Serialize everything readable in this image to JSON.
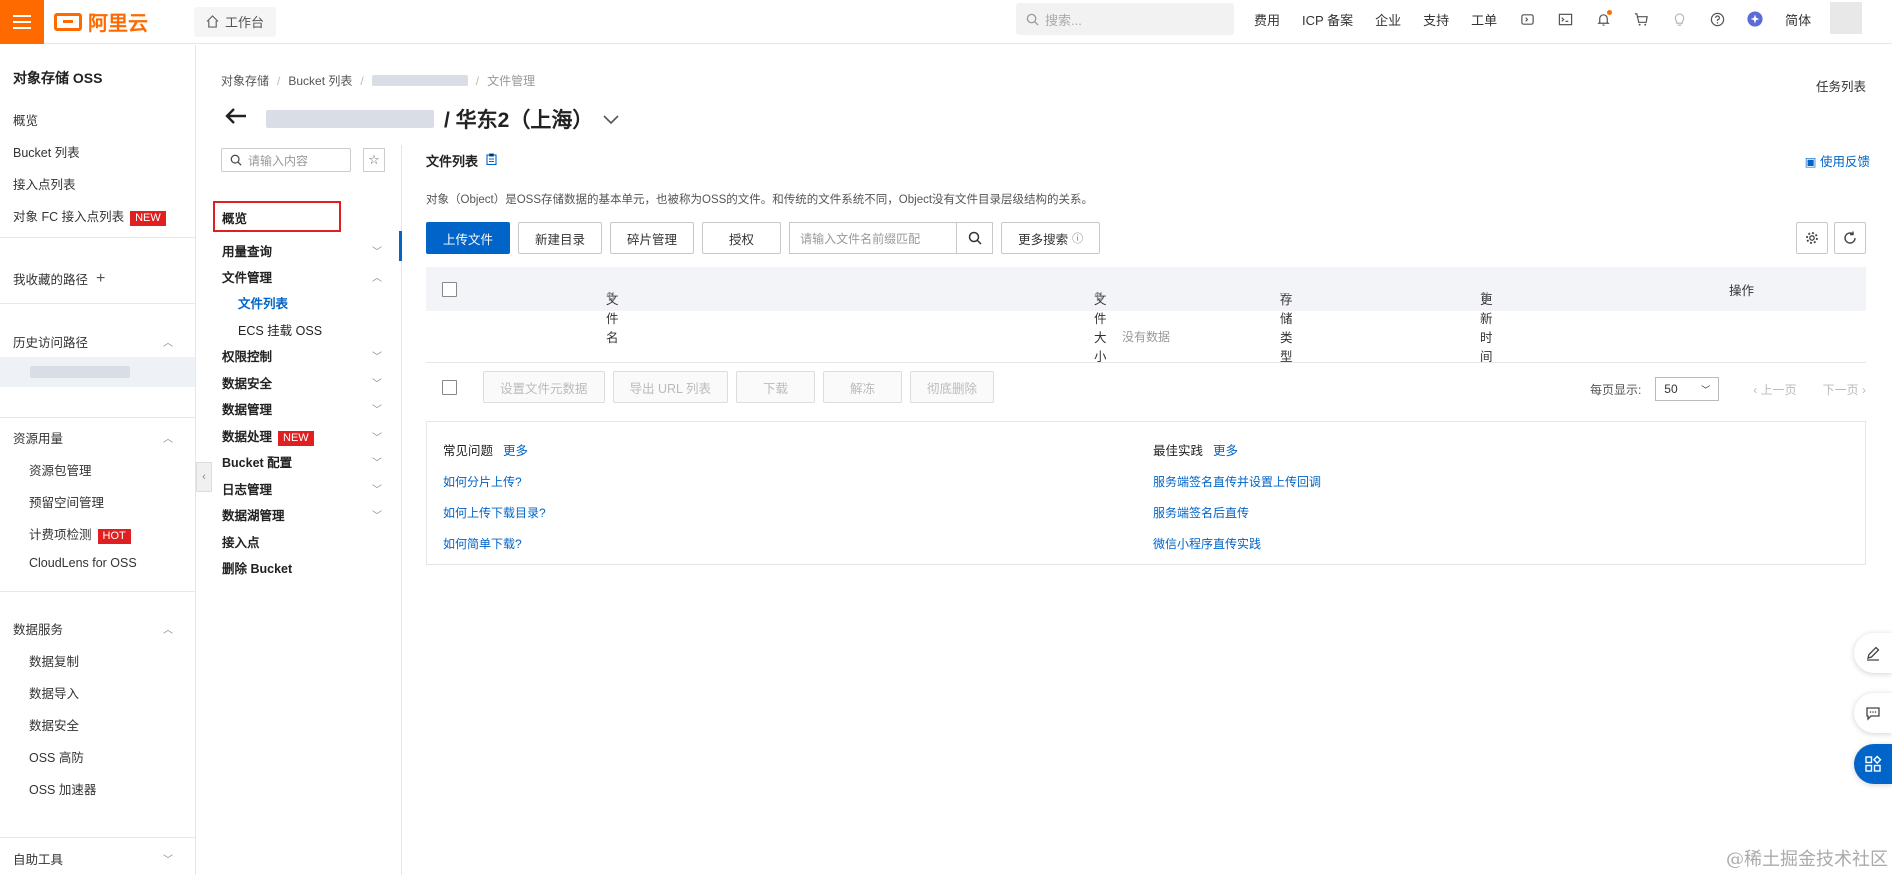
{
  "topbar": {
    "logo_text": "阿里云",
    "workbench": "工作台",
    "search_placeholder": "搜索...",
    "nav": [
      "费用",
      "ICP 备案",
      "企业",
      "支持",
      "工单"
    ],
    "lang": "简体"
  },
  "sidebar": {
    "title": "对象存储 OSS",
    "items": [
      "概览",
      "Bucket 列表",
      "接入点列表",
      "对象 FC 接入点列表"
    ],
    "new_badge": "NEW",
    "favorites": "我收藏的路径",
    "history": "历史访问路径",
    "resource": {
      "label": "资源用量",
      "items": [
        "资源包管理",
        "预留空间管理",
        "计费项检测",
        "CloudLens for OSS"
      ],
      "hot_badge": "HOT"
    },
    "data_service": {
      "label": "数据服务",
      "items": [
        "数据复制",
        "数据导入",
        "数据安全",
        "OSS 高防",
        "OSS 加速器"
      ]
    },
    "self_tools": "自助工具"
  },
  "breadcrumb": {
    "items": [
      "对象存储",
      "Bucket 列表"
    ],
    "current": "文件管理"
  },
  "tasks": "任务列表",
  "bucket_region": "/ 华东2（上海）",
  "subnav": {
    "search_placeholder": "请输入内容",
    "overview": "概览",
    "usage": "用量查询",
    "file_mgmt": "文件管理",
    "file_list": "文件列表",
    "ecs_mount": "ECS 挂载 OSS",
    "perm": "权限控制",
    "data_security": "数据安全",
    "data_mgmt": "数据管理",
    "data_proc": "数据处理",
    "new_badge": "NEW",
    "bucket_config": "Bucket 配置",
    "log_mgmt": "日志管理",
    "lake_mgmt": "数据湖管理",
    "access_point": "接入点",
    "delete_bucket": "删除 Bucket"
  },
  "content": {
    "title": "文件列表",
    "feedback": "使用反馈",
    "description": "对象（Object）是OSS存储数据的基本单元，也被称为OSS的文件。和传统的文件系统不同，Object没有文件目录层级结构的关系。",
    "buttons": {
      "upload": "上传文件",
      "new_dir": "新建目录",
      "fragments": "碎片管理",
      "authorize": "授权",
      "more_search": "更多搜索"
    },
    "filter_placeholder": "请输入文件名前缀匹配",
    "columns": {
      "name": "文件名",
      "size": "文件大小",
      "storage": "存储类型",
      "updated": "更新时间",
      "ops": "操作"
    },
    "empty": "没有数据",
    "bulk": {
      "meta": "设置文件元数据",
      "export": "导出 URL 列表",
      "download": "下载",
      "unfreeze": "解冻",
      "delete": "彻底删除"
    },
    "pager": {
      "per_page_label": "每页显示:",
      "per_page": "50",
      "prev": "上一页",
      "next": "下一页"
    }
  },
  "faq": {
    "left_title": "常见问题",
    "right_title": "最佳实践",
    "more": "更多",
    "left_links": [
      "如何分片上传?",
      "如何上传下载目录?",
      "如何简单下载?"
    ],
    "right_links": [
      "服务端签名直传并设置上传回调",
      "服务端签名后直传",
      "微信小程序直传实践"
    ]
  },
  "watermark": "@稀土掘金技术社区",
  "colors": {
    "accent": "#0064c8",
    "brand": "#ff6a00",
    "badge": "#e02020"
  }
}
